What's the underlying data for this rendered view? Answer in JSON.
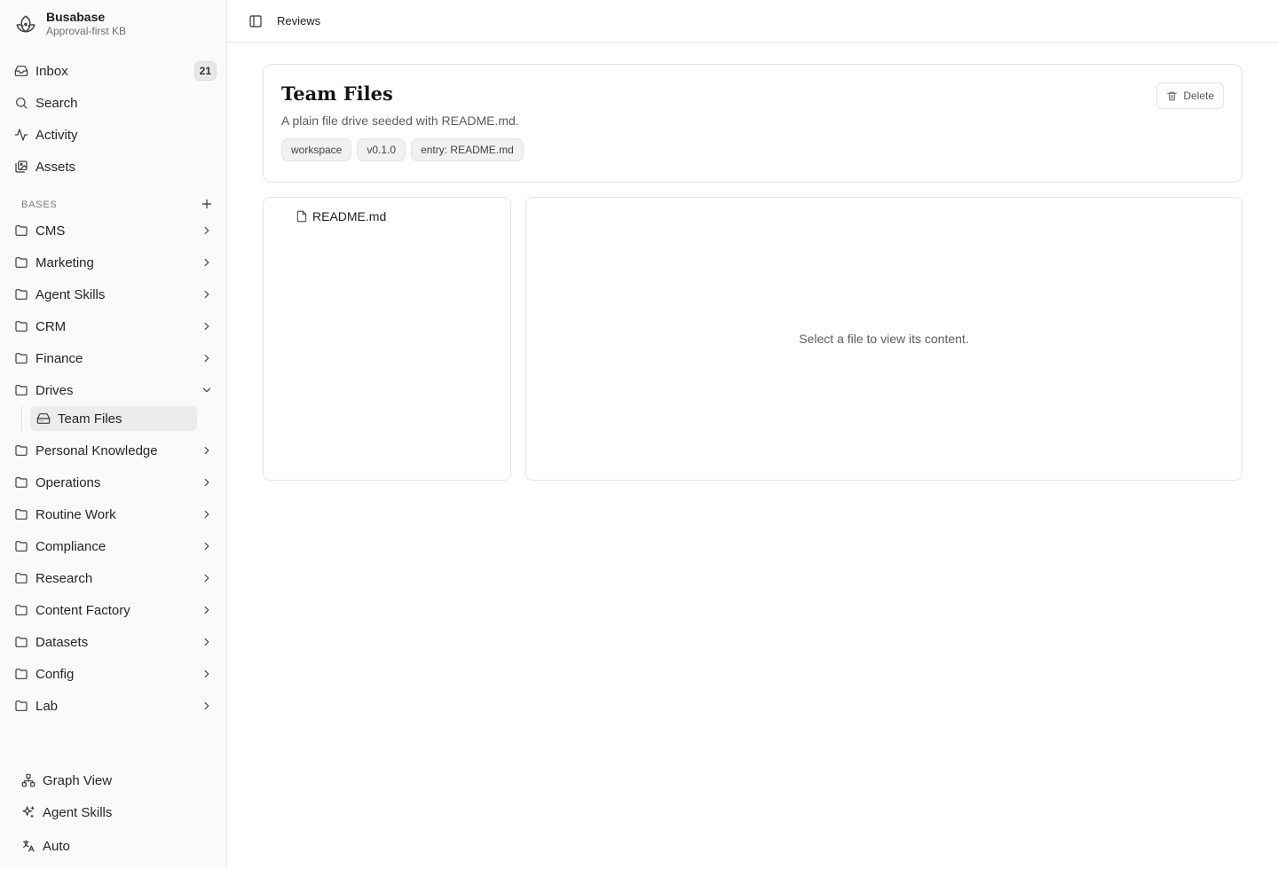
{
  "brand": {
    "name": "Busabase",
    "subtitle": "Approval-first KB",
    "logo_icon": "lotus-icon"
  },
  "nav": [
    {
      "label": "Inbox",
      "icon": "inbox-icon",
      "badge": "21"
    },
    {
      "label": "Search",
      "icon": "search-icon"
    },
    {
      "label": "Activity",
      "icon": "activity-icon"
    },
    {
      "label": "Assets",
      "icon": "images-icon"
    }
  ],
  "bases": {
    "label": "BASES",
    "items": [
      {
        "label": "CMS",
        "icon": "folder-icon",
        "expanded": false
      },
      {
        "label": "Marketing",
        "icon": "folder-icon",
        "expanded": false
      },
      {
        "label": "Agent Skills",
        "icon": "folder-icon",
        "expanded": false
      },
      {
        "label": "CRM",
        "icon": "folder-icon",
        "expanded": false
      },
      {
        "label": "Finance",
        "icon": "folder-icon",
        "expanded": false
      },
      {
        "label": "Drives",
        "icon": "folder-icon",
        "expanded": true
      },
      {
        "label": "Personal Knowledge",
        "icon": "folder-icon",
        "expanded": false
      },
      {
        "label": "Operations",
        "icon": "folder-icon",
        "expanded": false
      },
      {
        "label": "Routine Work",
        "icon": "folder-icon",
        "expanded": false
      },
      {
        "label": "Compliance",
        "icon": "folder-icon",
        "expanded": false
      },
      {
        "label": "Research",
        "icon": "folder-icon",
        "expanded": false
      },
      {
        "label": "Content Factory",
        "icon": "folder-icon",
        "expanded": false
      },
      {
        "label": "Datasets",
        "icon": "folder-icon",
        "expanded": false
      },
      {
        "label": "Config",
        "icon": "folder-icon",
        "expanded": false
      },
      {
        "label": "Lab",
        "icon": "folder-icon",
        "expanded": false
      }
    ],
    "drives_children": [
      {
        "label": "Team Files",
        "icon": "drive-icon"
      }
    ]
  },
  "footer": [
    {
      "label": "Graph View",
      "icon": "graph-icon"
    },
    {
      "label": "Agent Skills",
      "icon": "sparkles-icon"
    },
    {
      "label": "Auto",
      "icon": "language-icon"
    }
  ],
  "topbar": {
    "breadcrumb": "Reviews"
  },
  "page": {
    "title": "Team Files",
    "description": "A plain file drive seeded with README.md.",
    "tags": [
      "workspace",
      "v0.1.0",
      "entry: README.md"
    ],
    "delete_label": "Delete"
  },
  "files": [
    {
      "name": "README.md",
      "icon": "file-icon"
    }
  ],
  "viewer": {
    "empty_text": "Select a file to view its content."
  },
  "colors": {
    "sidebar_bg": "#fafafa",
    "border": "#e3e3e3",
    "active_item_bg": "#ececec"
  }
}
